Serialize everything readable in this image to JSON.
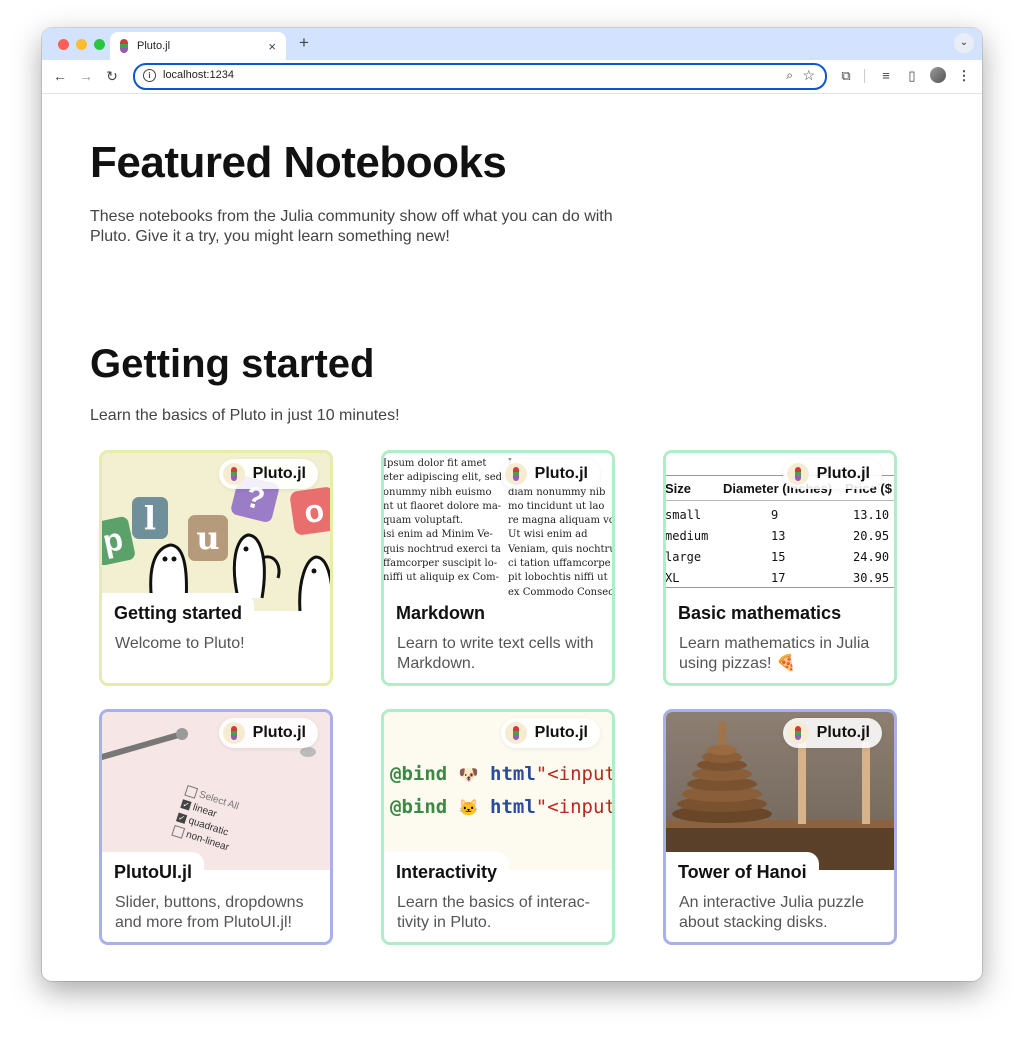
{
  "browser": {
    "tab_title": "Pluto.jl",
    "tab_close": "×",
    "new_tab": "+",
    "tab_menu": "⌄",
    "url": "localhost:1234",
    "icons": [
      "back-icon",
      "forward-icon",
      "reload-icon",
      "site-info-icon",
      "zoom-icon",
      "bookmark-star-icon",
      "extensions-icon",
      "media-control-icon",
      "side-panel-icon",
      "profile-avatar",
      "more-menu-icon"
    ]
  },
  "page": {
    "title": "Featured Notebooks",
    "lead": "These notebooks from the Julia community show off what you can do with Pluto. Give it a try, you might learn something new!",
    "section_title": "Getting started",
    "section_subtitle": "Learn the basics of Pluto in just 10 minutes!"
  },
  "badge_label": "Pluto.jl",
  "colors": {
    "yellow_border": "#e6ecae",
    "green_border": "#b0ecc5",
    "blue_border": "#a8b0e8",
    "pluto_red": "#cc3c3c",
    "pluto_green": "#4aa04a",
    "pluto_purple": "#9b59b6"
  },
  "cards": [
    {
      "title": "Getting started",
      "description": "Welcome to Pluto!"
    },
    {
      "title": "Markdown",
      "description": "Learn to write text cells with Markdown."
    },
    {
      "title": "Basic mathematics",
      "description": "Learn mathematics in Julia using pizzas! 🍕"
    },
    {
      "title": "PlutoUI.jl",
      "description": "Slider, buttons, dropdowns and more from PlutoUI.jl!"
    },
    {
      "title": "Interactivity",
      "description": "Learn the basics of interac-tivity in Pluto."
    },
    {
      "title": "Tower of Hanoi",
      "description": "An interactive Julia puzzle about stacking disks."
    }
  ],
  "card_images": {
    "getting_started_letters": [
      "p",
      "l",
      "u",
      "?",
      "o"
    ],
    "markdown_lines_left": [
      "Ipsum dolor fit amet",
      "eter adipiscing elit, sed",
      "onummy nibh euismo",
      "nt ut flaoret dolore ma-",
      "quam voluptaft.",
      "isi enim ad Minim Ve-",
      "quis nochtrud exerci ta-",
      "ffamcorper suscipit lo-",
      "niffi ut aliquip ex Com-"
    ],
    "markdown_lines_right": [
      "L",
      "",
      "diam nonummy nib",
      "mo tincidunt ut lao",
      "re magna aliquam volu",
      "Ut wisi enim ad",
      "Veniam, quis nochtru",
      "ci tation uffamcorpe",
      "pit lobochtis niffi ut",
      "ex Commodo Consec"
    ],
    "math_table": {
      "headers": [
        "Size",
        "Diameter (inches)",
        "Price ($"
      ],
      "rows": [
        [
          "small",
          "9",
          "13.10"
        ],
        [
          "medium",
          "13",
          "20.95"
        ],
        [
          "large",
          "15",
          "24.90"
        ],
        [
          "XL",
          "17",
          "30.95"
        ]
      ]
    },
    "plutoui_checks": [
      {
        "label": "Select All",
        "checked": false
      },
      {
        "label": "linear",
        "checked": true
      },
      {
        "label": "quadratic",
        "checked": true
      },
      {
        "label": "non-linear",
        "checked": false
      }
    ],
    "interactivity_lines": [
      {
        "macro": "@bind",
        "emoji": "🐶",
        "fn": "html",
        "str": "\"<input"
      },
      {
        "macro": "@bind",
        "emoji": "🐱",
        "fn": "html",
        "str": "\"<input"
      }
    ]
  }
}
